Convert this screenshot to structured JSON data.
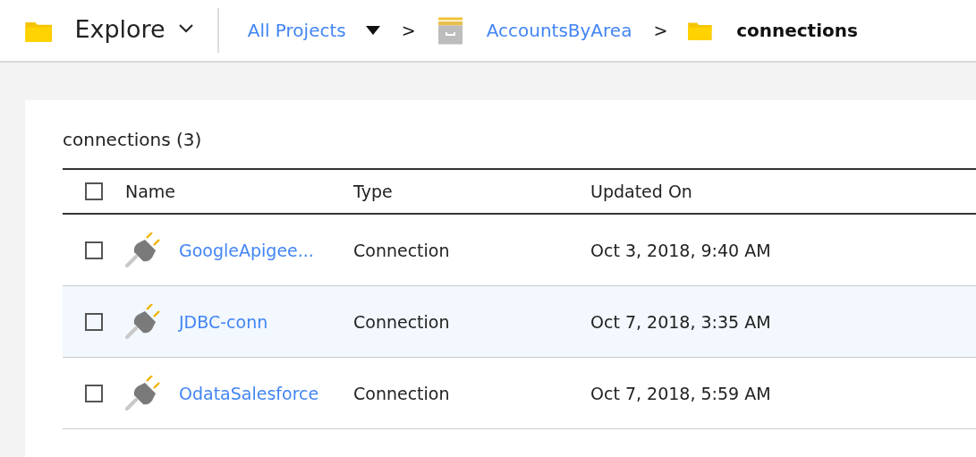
{
  "header": {
    "title": "Explore"
  },
  "breadcrumb": [
    {
      "kind": "link",
      "label": "All Projects"
    },
    {
      "kind": "project",
      "label": "AccountsByArea",
      "separator": ">"
    },
    {
      "kind": "current",
      "label": "connections",
      "separator": ">"
    }
  ],
  "panel": {
    "title": "connections (3)"
  },
  "table": {
    "columns": [
      "Name",
      "Type",
      "Updated On"
    ],
    "all_checked": false,
    "rows": [
      {
        "name": "GoogleApigee...",
        "type": "Connection",
        "updated": "Oct 3, 2018, 9:40 AM",
        "checked": false,
        "highlighted": false
      },
      {
        "name": "JDBC-conn",
        "type": "Connection",
        "updated": "Oct 7, 2018, 3:35 AM",
        "checked": false,
        "highlighted": true
      },
      {
        "name": "OdataSalesforce",
        "type": "Connection",
        "updated": "Oct 7, 2018, 5:59 AM",
        "checked": false,
        "highlighted": false
      }
    ]
  }
}
